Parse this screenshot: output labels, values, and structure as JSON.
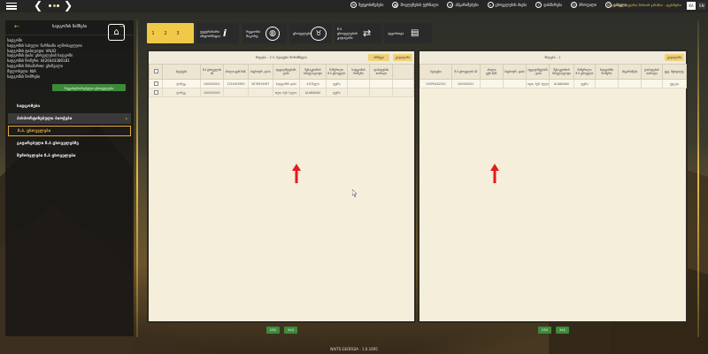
{
  "topbar": {
    "menu": [
      {
        "icon": "inbox-icon",
        "label": "შეტყობინებები"
      },
      {
        "icon": "calendar-icon",
        "label": "მოვლენების ჟურნალი"
      },
      {
        "icon": "document-icon",
        "label": "ანგარიშებები"
      },
      {
        "icon": "search-icon",
        "label": "ცხოველების ძიება"
      },
      {
        "icon": "help-icon",
        "label": "დახმარება"
      },
      {
        "icon": "user-icon",
        "label": "პროფილი"
      },
      {
        "icon": "power-icon",
        "label": "გასვლა"
      }
    ],
    "user": "გიორგი (ბეჟანი) მარიამ ჯანაშია - ფერმერი",
    "lang_ka": "KA",
    "lang_en": "EN"
  },
  "left_panel": {
    "title": "სადგომის ნიშნები",
    "info_lines": [
      "სადგომი",
      "სადგომის სახელი: ჩარჩიანი აღმოსავლეთი",
      "სადგომის ტიპი/კოდი: VALID",
      "სადგომის ტიპი: ცხოველების სადგომი",
      "სადგომის ნომერი: 4426443380181",
      "სადგომის მისამართი: ცხინვალი",
      "მფლობელი: N/A",
      "სადგომის ნომრები"
    ],
    "green_button": "რეგისტრირებული ცხოველები",
    "menu": [
      {
        "label": "სადგომები"
      },
      {
        "label": "პასპორტიზებული ბიოჭები"
      },
      {
        "label": "ჩ.ბ. ცხოველები"
      },
      {
        "label": "გატარებული ჩ.ბ ცხოველებზე"
      },
      {
        "label": "შემოსვლები ჩ.ბ ცხოველები"
      }
    ]
  },
  "toolbar": {
    "step_labels": [
      "1",
      "2",
      "3"
    ],
    "buttons": [
      {
        "label": "ვეტერინარი ინფორმაცია",
        "icon": "info-icon"
      },
      {
        "label": "რეგიონი მაკონტ.",
        "icon": "globe-icon"
      },
      {
        "label": "ცხოველები",
        "icon": "livestock-icon"
      },
      {
        "label": "ჩ.ბ ცხოველების გადატანა",
        "icon": "transfer-icon"
      },
      {
        "label": "ატვირთვა",
        "icon": "clipboard-icon"
      }
    ]
  },
  "left_table": {
    "title": "მიღება - 2   ბ. სტატუსი მონიშნული",
    "btn_select": "არჩევა",
    "btn_move": "გადატანა",
    "headers": [
      "სტატუსი",
      "ჩ.ბ ცხოველის ID",
      "ახალი ყურ.ნიშ.",
      "საცხოვრ. ტიპი",
      "ადგილმდებარ. ტიპი",
      "მესაკუთრის სახელი/კოდი",
      "ჩაწერილი ჩ.ბ ცხოველი",
      "სადგომის ნომერი",
      "დაბადების თარიღი"
    ],
    "rows": [
      [
        "დარეგ.",
        "000000001",
        "1234567890",
        "0878934567",
        "სადგომის ტიპი",
        "4-8 წელი",
        "ფურა",
        "",
        ""
      ],
      [
        "დარეგ.",
        "000000003",
        "",
        "",
        "თეთ. ბუნ. ხელი.",
        "ALABANAS",
        "ფურა",
        "",
        ""
      ]
    ]
  },
  "right_table": {
    "title": "მიღება - 1",
    "btn_move": "გადატანა",
    "headers": [
      "სტატუსი",
      "ჩ.ბ ცხოველის ID",
      "ახალი ყურ.ნიშ.",
      "საცხოვრ. ტიპი",
      "ადგილმდებარ. ტიპი",
      "მესაკუთრის სახელი/კოდი",
      "ჩაწერილი ჩ.ბ ცხოველი",
      "სადგომის ნომერი",
      "ანგარიშები",
      "დაბადების თარიღი",
      "ვეტ. მეთვალყ."
    ],
    "rows": [
      [
        "GLYPHAS2020",
        "000000021",
        "",
        "",
        "თეთ. ბუნ. ხელი.",
        "ALABANAS",
        "ფურა",
        "",
        "",
        "",
        "ვეტ.ტი"
      ]
    ]
  },
  "export": {
    "csv": "CSV",
    "xls": "XLS"
  },
  "footer": {
    "version": "NAITS GEORGIA - 1.0.1695"
  },
  "colors": {
    "accent": "#f0c948",
    "green": "#3c8a3a",
    "arrow": "#e31b1b"
  }
}
